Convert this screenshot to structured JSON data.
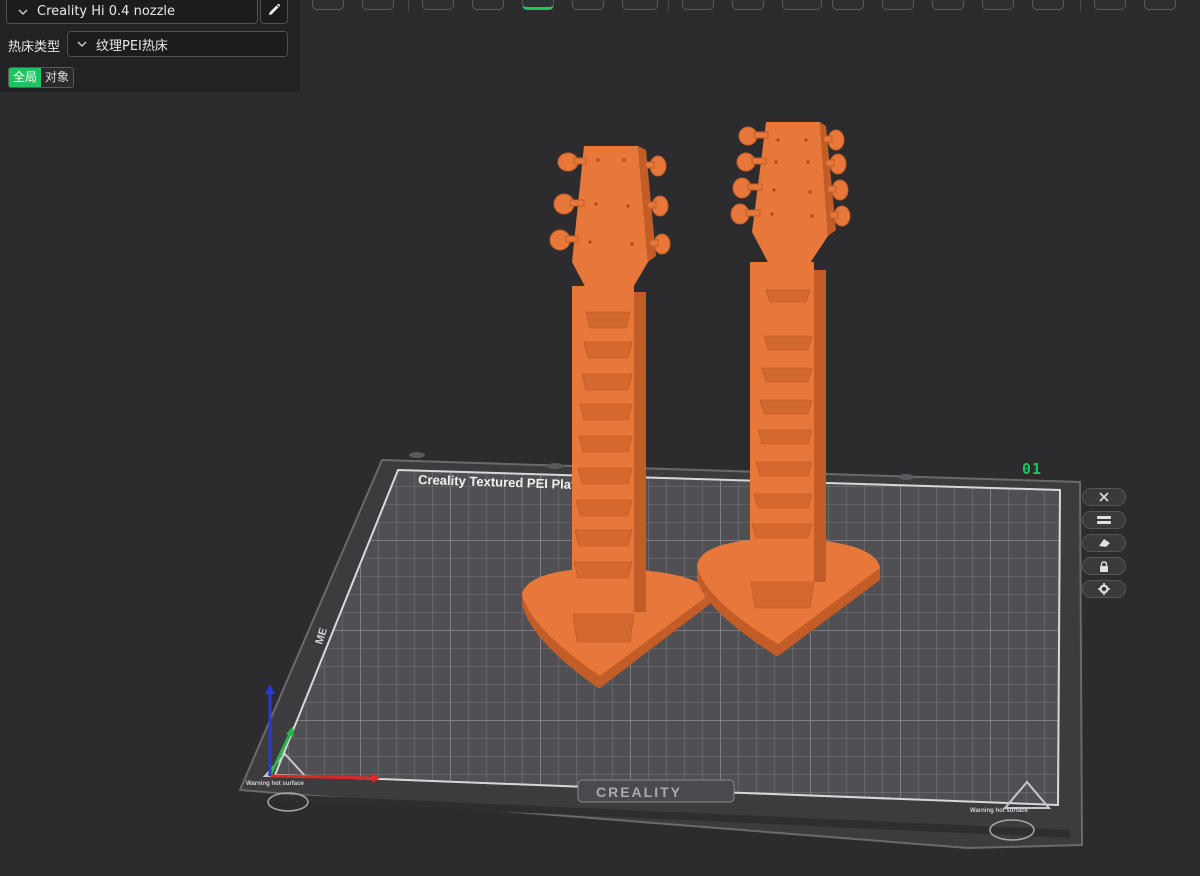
{
  "left_panel": {
    "printer": {
      "value": "Creality Hi 0.4 nozzle",
      "edit_icon": "pencil-icon"
    },
    "bed_type": {
      "label": "热床类型",
      "value": "纹理PEI热床"
    },
    "scope_toggle": {
      "global_label": "全局",
      "object_label": "对象",
      "active": "global"
    }
  },
  "toolbar": {
    "icons": [
      "add-cube-icon",
      "keyboard-icon",
      "orient-icon",
      "arrange-icon",
      "layer-view-icon",
      "split-view-icon",
      "ruler-icon",
      "cut-icon",
      "support-paint-icon",
      "seam-icon",
      "hollow-icon",
      "text-icon",
      "measure-icon",
      "assembly-icon",
      "grid-icon",
      "settings-icon"
    ],
    "active_icon": "layer-view-icon"
  },
  "viewport": {
    "plate": {
      "number": "01",
      "title": "Creality Textured PEI Plate",
      "brand": "CREALITY",
      "side_text": "ME",
      "warning_left": "Warning hot surface",
      "warning_right": "Warning hot surface"
    },
    "models": [
      {
        "name": "guitar-stand-left",
        "color": "#e8773a"
      },
      {
        "name": "guitar-stand-right",
        "color": "#e8773a"
      }
    ],
    "axes": {
      "x_color": "#d42a2a",
      "y_color": "#2bb44a",
      "z_color": "#2a3ad4"
    }
  },
  "side_tools": [
    "close-icon",
    "list-icon",
    "eraser-icon",
    "lock-icon",
    "gear-icon"
  ],
  "colors": {
    "accent": "#1ec45f",
    "model": "#e8773a",
    "background": "#2c2c2e",
    "panel": "#222224"
  }
}
